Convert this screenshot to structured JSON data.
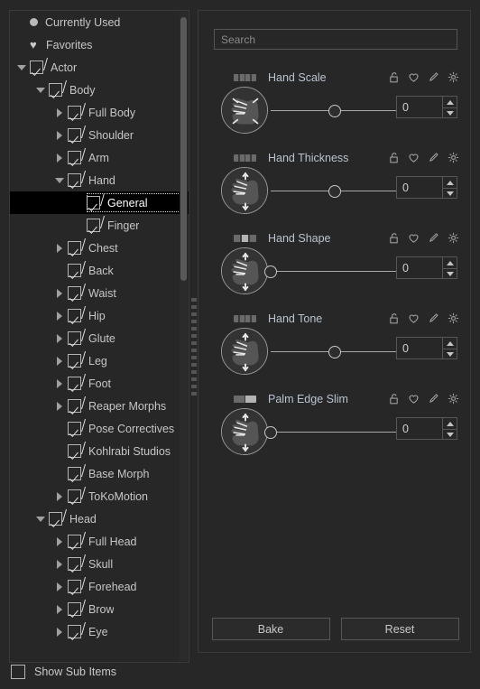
{
  "colors": {
    "background": "#272727",
    "panel_border": "#3a3a3a",
    "text": "#c6c6c6",
    "param_title": "#b9c4d1",
    "selection_background": "#000000",
    "scrollbar_thumb": "#595959"
  },
  "tree": {
    "scrollbar": {
      "name": "tree-vertical-scrollbar"
    },
    "items": [
      {
        "label": "Currently Used",
        "indent": 0,
        "icon": "dot-icon",
        "arrow": "none",
        "checkbox": "none",
        "selected": false
      },
      {
        "label": "Favorites",
        "indent": 0,
        "icon": "heart-icon",
        "arrow": "none",
        "checkbox": "none",
        "selected": false
      },
      {
        "label": "Actor",
        "indent": 0,
        "icon": "none",
        "arrow": "open",
        "checkbox": "checked",
        "selected": false
      },
      {
        "label": "Body",
        "indent": 1,
        "icon": "none",
        "arrow": "open",
        "checkbox": "checked",
        "selected": false
      },
      {
        "label": "Full Body",
        "indent": 2,
        "icon": "none",
        "arrow": "closed",
        "checkbox": "checked",
        "selected": false
      },
      {
        "label": "Shoulder",
        "indent": 2,
        "icon": "none",
        "arrow": "closed",
        "checkbox": "checked",
        "selected": false
      },
      {
        "label": "Arm",
        "indent": 2,
        "icon": "none",
        "arrow": "closed",
        "checkbox": "checked",
        "selected": false
      },
      {
        "label": "Hand",
        "indent": 2,
        "icon": "none",
        "arrow": "open",
        "checkbox": "checked",
        "selected": false
      },
      {
        "label": "General",
        "indent": 3,
        "icon": "none",
        "arrow": "none",
        "checkbox": "checked",
        "selected": true
      },
      {
        "label": "Finger",
        "indent": 3,
        "icon": "none",
        "arrow": "none",
        "checkbox": "checked",
        "selected": false
      },
      {
        "label": "Chest",
        "indent": 2,
        "icon": "none",
        "arrow": "closed",
        "checkbox": "checked",
        "selected": false
      },
      {
        "label": "Back",
        "indent": 2,
        "icon": "none",
        "arrow": "none",
        "checkbox": "checked",
        "selected": false
      },
      {
        "label": "Waist",
        "indent": 2,
        "icon": "none",
        "arrow": "closed",
        "checkbox": "checked",
        "selected": false
      },
      {
        "label": "Hip",
        "indent": 2,
        "icon": "none",
        "arrow": "closed",
        "checkbox": "checked",
        "selected": false
      },
      {
        "label": "Glute",
        "indent": 2,
        "icon": "none",
        "arrow": "closed",
        "checkbox": "checked",
        "selected": false
      },
      {
        "label": "Leg",
        "indent": 2,
        "icon": "none",
        "arrow": "closed",
        "checkbox": "checked",
        "selected": false
      },
      {
        "label": "Foot",
        "indent": 2,
        "icon": "none",
        "arrow": "closed",
        "checkbox": "checked",
        "selected": false
      },
      {
        "label": "Reaper Morphs",
        "indent": 2,
        "icon": "none",
        "arrow": "closed",
        "checkbox": "checked",
        "selected": false
      },
      {
        "label": "Pose Correctives",
        "indent": 2,
        "icon": "none",
        "arrow": "none",
        "checkbox": "checked",
        "selected": false
      },
      {
        "label": "Kohlrabi Studios",
        "indent": 2,
        "icon": "none",
        "arrow": "none",
        "checkbox": "checked",
        "selected": false
      },
      {
        "label": "Base Morph",
        "indent": 2,
        "icon": "none",
        "arrow": "none",
        "checkbox": "checked",
        "selected": false
      },
      {
        "label": "ToKoMotion",
        "indent": 2,
        "icon": "none",
        "arrow": "closed",
        "checkbox": "checked",
        "selected": false
      },
      {
        "label": "Head",
        "indent": 1,
        "icon": "none",
        "arrow": "open",
        "checkbox": "checked",
        "selected": false
      },
      {
        "label": "Full Head",
        "indent": 2,
        "icon": "none",
        "arrow": "closed",
        "checkbox": "checked",
        "selected": false
      },
      {
        "label": "Skull",
        "indent": 2,
        "icon": "none",
        "arrow": "closed",
        "checkbox": "checked",
        "selected": false
      },
      {
        "label": "Forehead",
        "indent": 2,
        "icon": "none",
        "arrow": "closed",
        "checkbox": "checked",
        "selected": false
      },
      {
        "label": "Brow",
        "indent": 2,
        "icon": "none",
        "arrow": "closed",
        "checkbox": "checked",
        "selected": false
      },
      {
        "label": "Eye",
        "indent": 2,
        "icon": "none",
        "arrow": "closed",
        "checkbox": "checked",
        "selected": false
      }
    ]
  },
  "footer": {
    "show_sub_items_label": "Show Sub Items",
    "show_sub_items_checked": false
  },
  "search": {
    "placeholder": "Search",
    "value": ""
  },
  "parameters": [
    {
      "title": "Hand Scale",
      "value": "0",
      "slider_percent": 50,
      "pill_segments": 4,
      "pill_lit_index": -1,
      "thumb": "hand-scale-icon",
      "icons": [
        "unlock-icon",
        "favorite-heart-icon",
        "edit-pencil-icon",
        "settings-gear-icon"
      ]
    },
    {
      "title": "Hand Thickness",
      "value": "0",
      "slider_percent": 50,
      "pill_segments": 4,
      "pill_lit_index": -1,
      "thumb": "hand-thickness-icon",
      "icons": [
        "unlock-icon",
        "favorite-heart-icon",
        "edit-pencil-icon",
        "settings-gear-icon"
      ]
    },
    {
      "title": "Hand Shape",
      "value": "0",
      "slider_percent": 0,
      "pill_segments": 3,
      "pill_lit_index": 1,
      "thumb": "hand-shape-icon",
      "icons": [
        "unlock-icon",
        "favorite-heart-icon",
        "edit-pencil-icon",
        "settings-gear-icon"
      ]
    },
    {
      "title": "Hand Tone",
      "value": "0",
      "slider_percent": 50,
      "pill_segments": 4,
      "pill_lit_index": -1,
      "thumb": "hand-tone-icon",
      "icons": [
        "unlock-icon",
        "favorite-heart-icon",
        "edit-pencil-icon",
        "settings-gear-icon"
      ]
    },
    {
      "title": "Palm Edge Slim",
      "value": "0",
      "slider_percent": 0,
      "pill_segments": 2,
      "pill_lit_index": 1,
      "thumb": "palm-edge-slim-icon",
      "icons": [
        "unlock-icon",
        "favorite-heart-icon",
        "edit-pencil-icon",
        "settings-gear-icon"
      ]
    }
  ],
  "actions": {
    "bake_label": "Bake",
    "reset_label": "Reset"
  }
}
